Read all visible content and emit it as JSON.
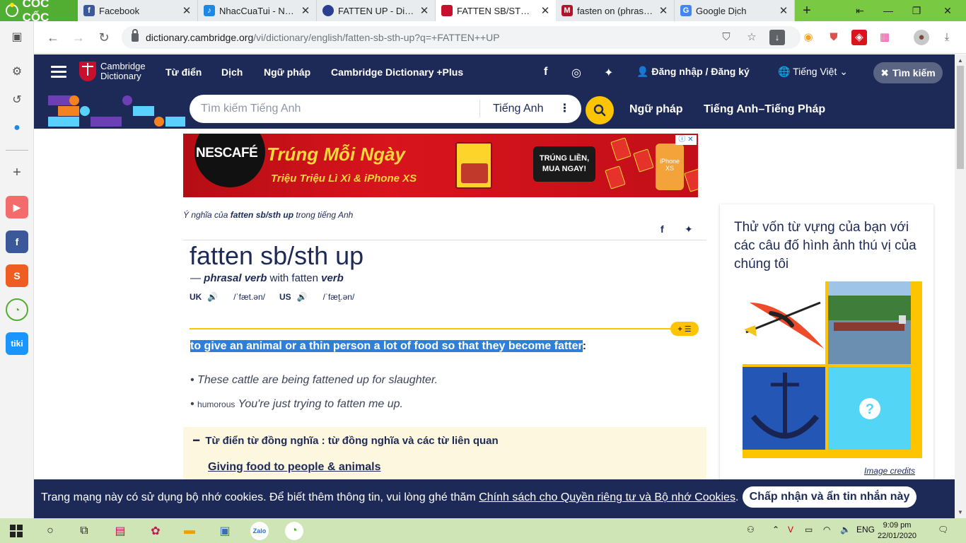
{
  "browser": {
    "brand": "CỐC CỐC",
    "tabs": [
      {
        "title": "Facebook",
        "favicon_color": "#3b5998",
        "favicon_glyph": "f"
      },
      {
        "title": "NhacCuaTui - Nghe n",
        "favicon_color": "#1e88e5",
        "favicon_glyph": "♪"
      },
      {
        "title": "FATTEN UP - Did you",
        "favicon_color": "#2a3f8f",
        "favicon_glyph": "●"
      },
      {
        "title": "FATTEN SB/STH UP | t",
        "favicon_color": "#c8102e",
        "favicon_glyph": "⛨",
        "active": true
      },
      {
        "title": "fasten on (phrasal ve",
        "favicon_color": "#b2152b",
        "favicon_glyph": "M"
      },
      {
        "title": "Google Dịch",
        "favicon_color": "#4285f4",
        "favicon_glyph": "G"
      }
    ],
    "url": {
      "host": "dictionary.cambridge.org",
      "path": "/vi/dictionary/english/fatten-sb-sth-up?q=+FATTEN++UP"
    }
  },
  "site": {
    "logo_line1": "Cambridge",
    "logo_line2": "Dictionary",
    "nav": [
      "Từ điển",
      "Dịch",
      "Ngữ pháp",
      "Cambridge Dictionary +Plus"
    ],
    "login": "Đăng nhập / Đăng ký",
    "language": "Tiếng Việt",
    "search_toggle": "Tìm kiếm",
    "search_placeholder": "Tìm kiếm Tiếng Anh",
    "search_language": "Tiếng Anh",
    "sub_links": [
      "Ngữ pháp",
      "Tiếng Anh–Tiếng Pháp"
    ]
  },
  "ad": {
    "brand": "NESCAFÉ",
    "headline": "Trúng Mỗi Ngày",
    "subline": "Triệu Triệu Lì Xì & iPhone XS",
    "cta": "TRÚNG LIỀN, MUA NGAY!",
    "phone_label": "iPhone XS"
  },
  "entry": {
    "crumb_prefix": "Ý nghĩa của ",
    "crumb_word": "fatten sb/sth up",
    "crumb_suffix": " trong tiếng Anh",
    "headword": "fatten sb/sth up",
    "pos_dash": "— ",
    "pos": "phrasal verb",
    "pos_with": " with fatten ",
    "pos_base": "verb",
    "uk_label": "UK",
    "uk_ipa": "/ˈfæt.ən/",
    "us_label": "US",
    "us_ipa": "/ˈfæt̬.ən/",
    "definition": "to give an animal or a thin person a lot of food so that they become fatter",
    "definition_end": ":",
    "examples": [
      {
        "label": "",
        "text": "These cattle are being fattened up for slaughter."
      },
      {
        "label": "humorous",
        "text": "You're just trying to fatten me up."
      }
    ],
    "thesaurus_title": "Từ điển từ đồng nghĩa : từ đồng nghĩa và các từ liên quan",
    "thesaurus_link": "Giving food to people & animals"
  },
  "quiz": {
    "title": "Thử vốn từ vựng của bạn với các câu đố hình ảnh thú vị của chúng tôi",
    "credits": "Image credits"
  },
  "cookie": {
    "text_before": "Trang mạng này có sử dụng bộ nhớ cookies. Để biết thêm thông tin, vui lòng ghé thăm ",
    "link": "Chính sách cho Quyền riêng tư và Bộ nhớ Cookies",
    "text_after": ".",
    "button": "Chấp nhận và ẩn tin nhắn này"
  },
  "taskbar": {
    "lang": "ENG",
    "time": "9:09 pm",
    "date": "22/01/2020"
  }
}
